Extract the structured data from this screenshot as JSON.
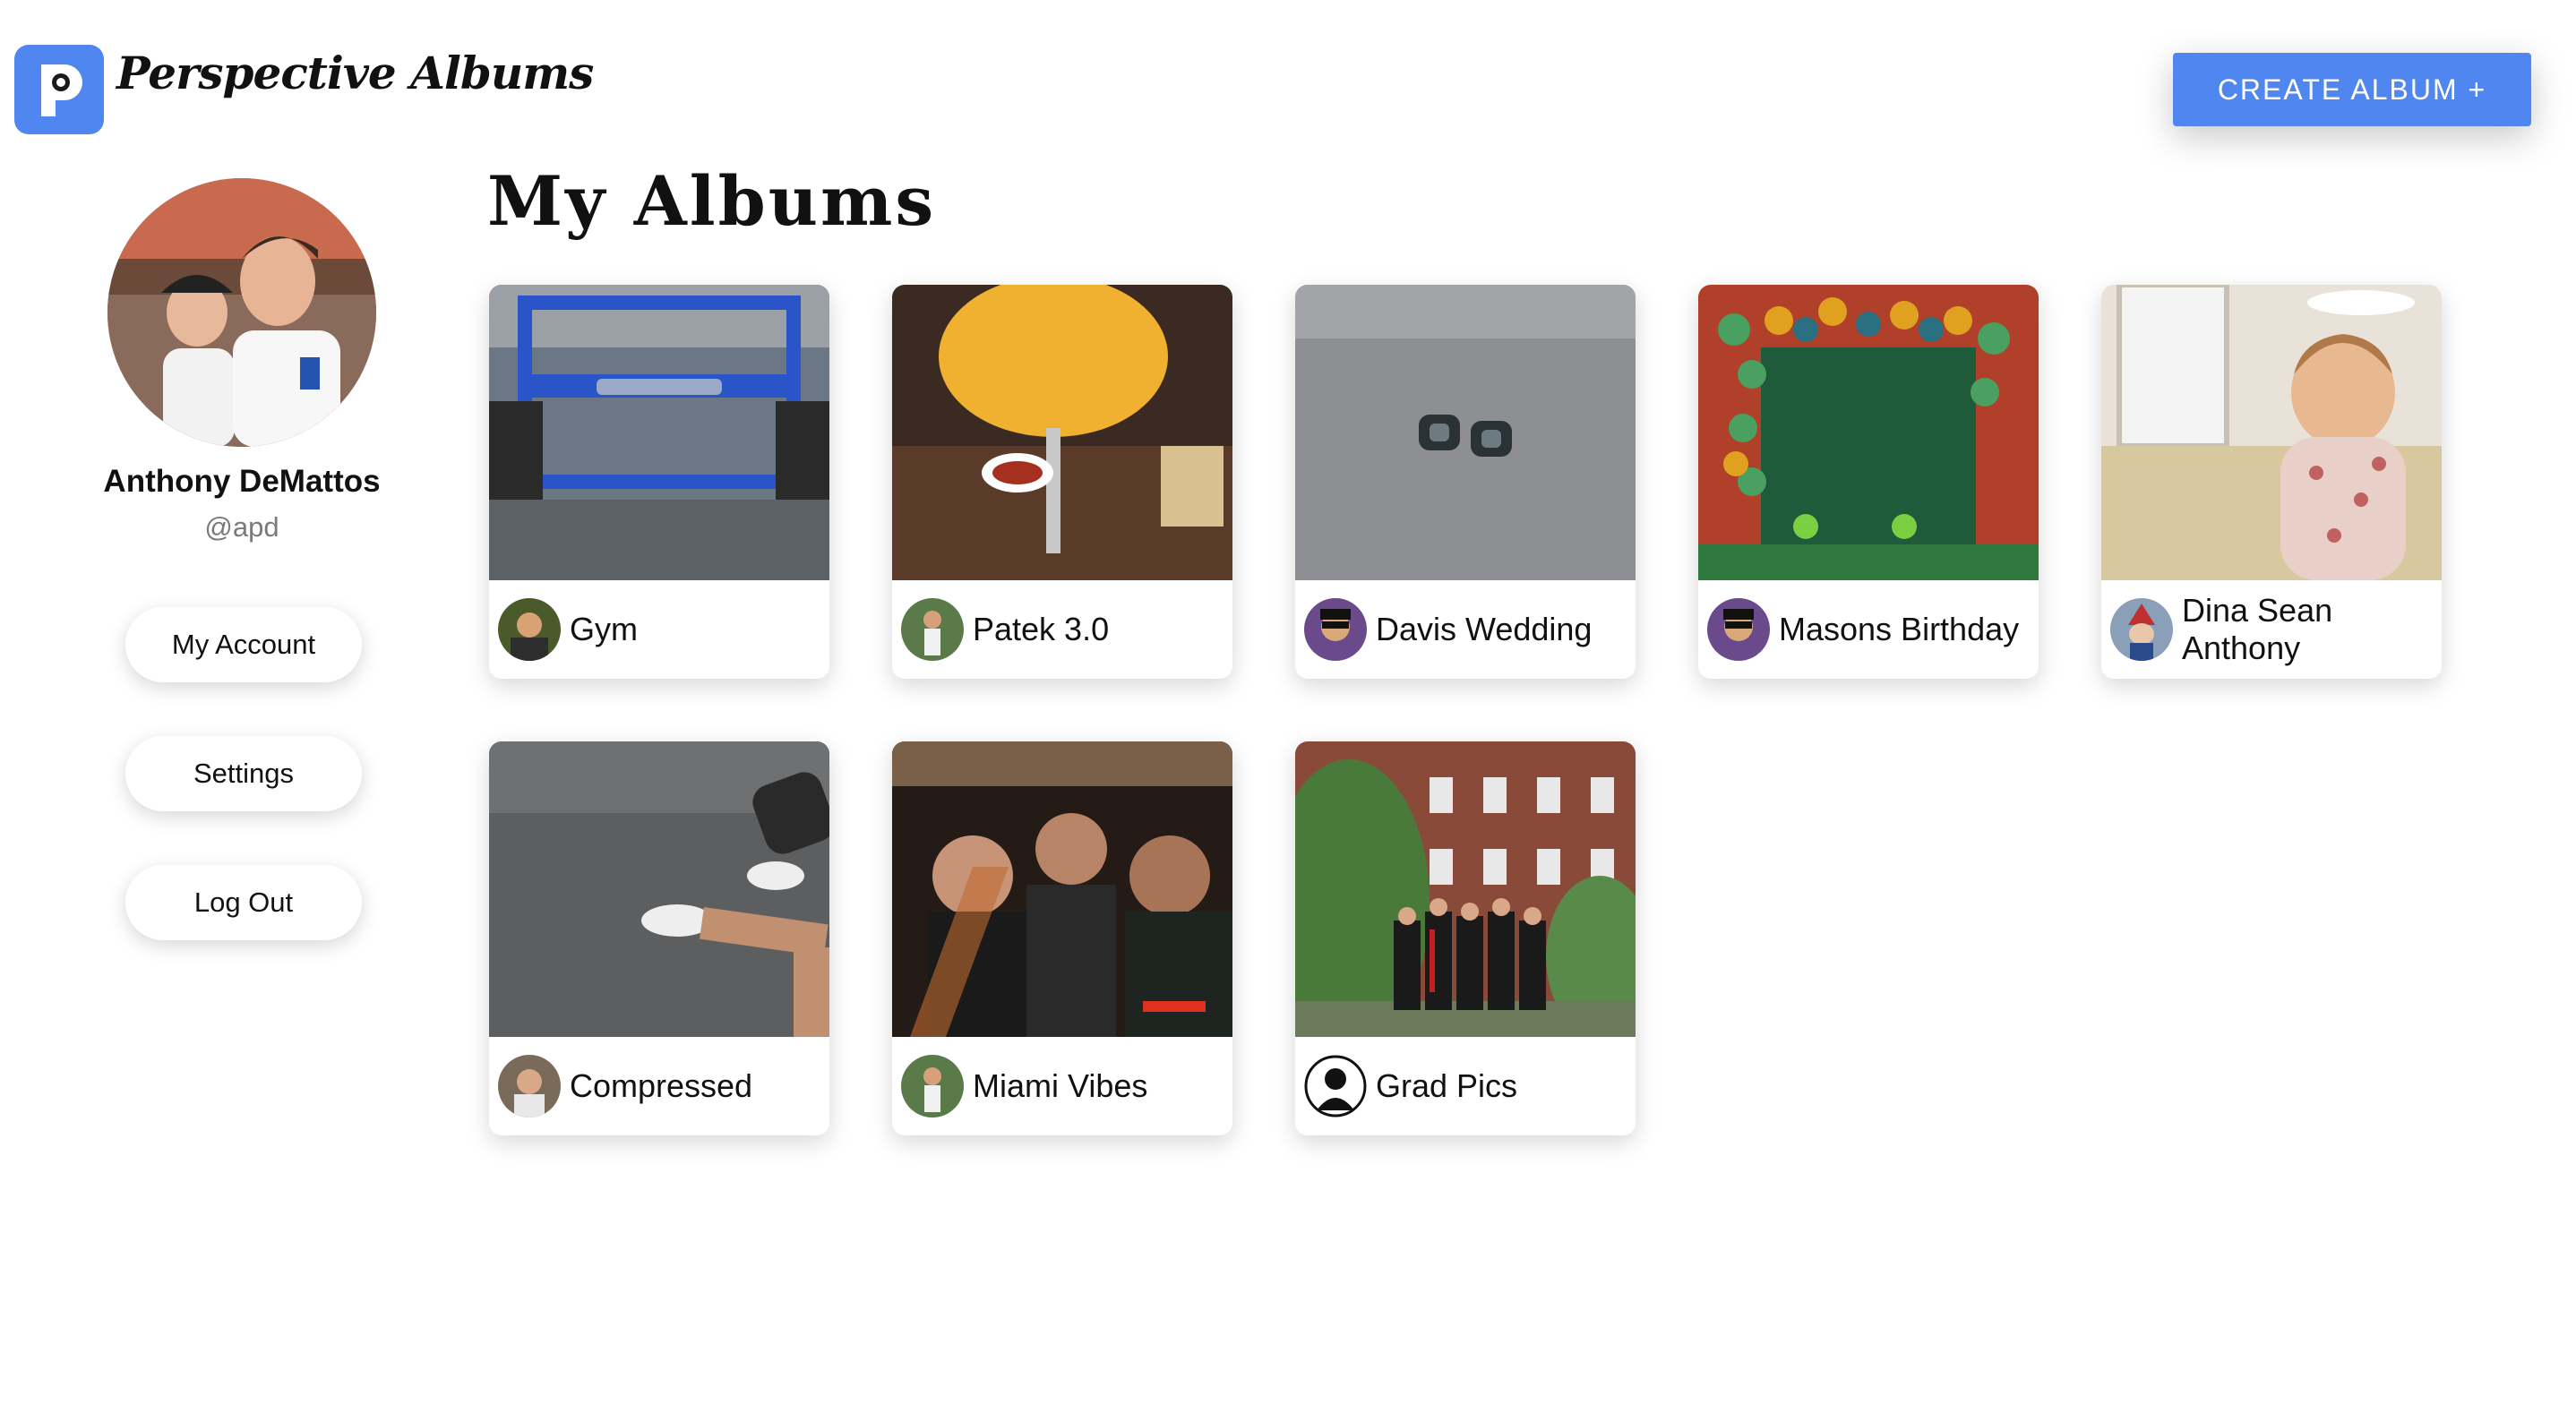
{
  "header": {
    "app_title": "Perspective Albums",
    "logo_letter": "P",
    "create_button_label": "CREATE ALBUM +"
  },
  "sidebar": {
    "user_name": "Anthony DeMattos",
    "user_handle": "@apd",
    "buttons": [
      {
        "label": "My Account"
      },
      {
        "label": "Settings"
      },
      {
        "label": "Log Out"
      }
    ]
  },
  "main": {
    "title": "My Albums",
    "albums": [
      {
        "name": "Gym"
      },
      {
        "name": "Patek 3.0"
      },
      {
        "name": "Davis Wedding"
      },
      {
        "name": "Masons Birthday"
      },
      {
        "name": "Dina Sean Anthony"
      },
      {
        "name": "Compressed"
      },
      {
        "name": "Miami Vibes"
      },
      {
        "name": "Grad Pics"
      }
    ]
  },
  "colors": {
    "accent": "#4f86ef",
    "background": "#ffffff",
    "muted_text": "#7a7a7a"
  }
}
